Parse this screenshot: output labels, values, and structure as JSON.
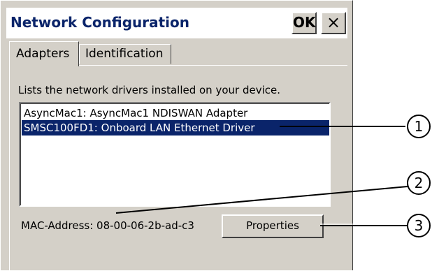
{
  "window": {
    "title": "Network Configuration",
    "ok_label": "OK",
    "close_label": "×"
  },
  "tabs": [
    {
      "label": "Adapters",
      "selected": true
    },
    {
      "label": "Identification",
      "selected": false
    }
  ],
  "description": "Lists the network drivers installed on your device.",
  "adapters": [
    {
      "label": "AsyncMac1: AsyncMac1 NDISWAN Adapter",
      "selected": false
    },
    {
      "label": "SMSC100FD1: Onboard LAN Ethernet Driver",
      "selected": true
    }
  ],
  "mac_address": "MAC-Address: 08-00-06-2b-ad-c3",
  "properties_label": "Properties",
  "callouts": [
    "1",
    "2",
    "3"
  ],
  "colors": {
    "title_text": "#0a246a",
    "selection_bg": "#0a246a",
    "dialog_bg": "#d4d0c8"
  }
}
